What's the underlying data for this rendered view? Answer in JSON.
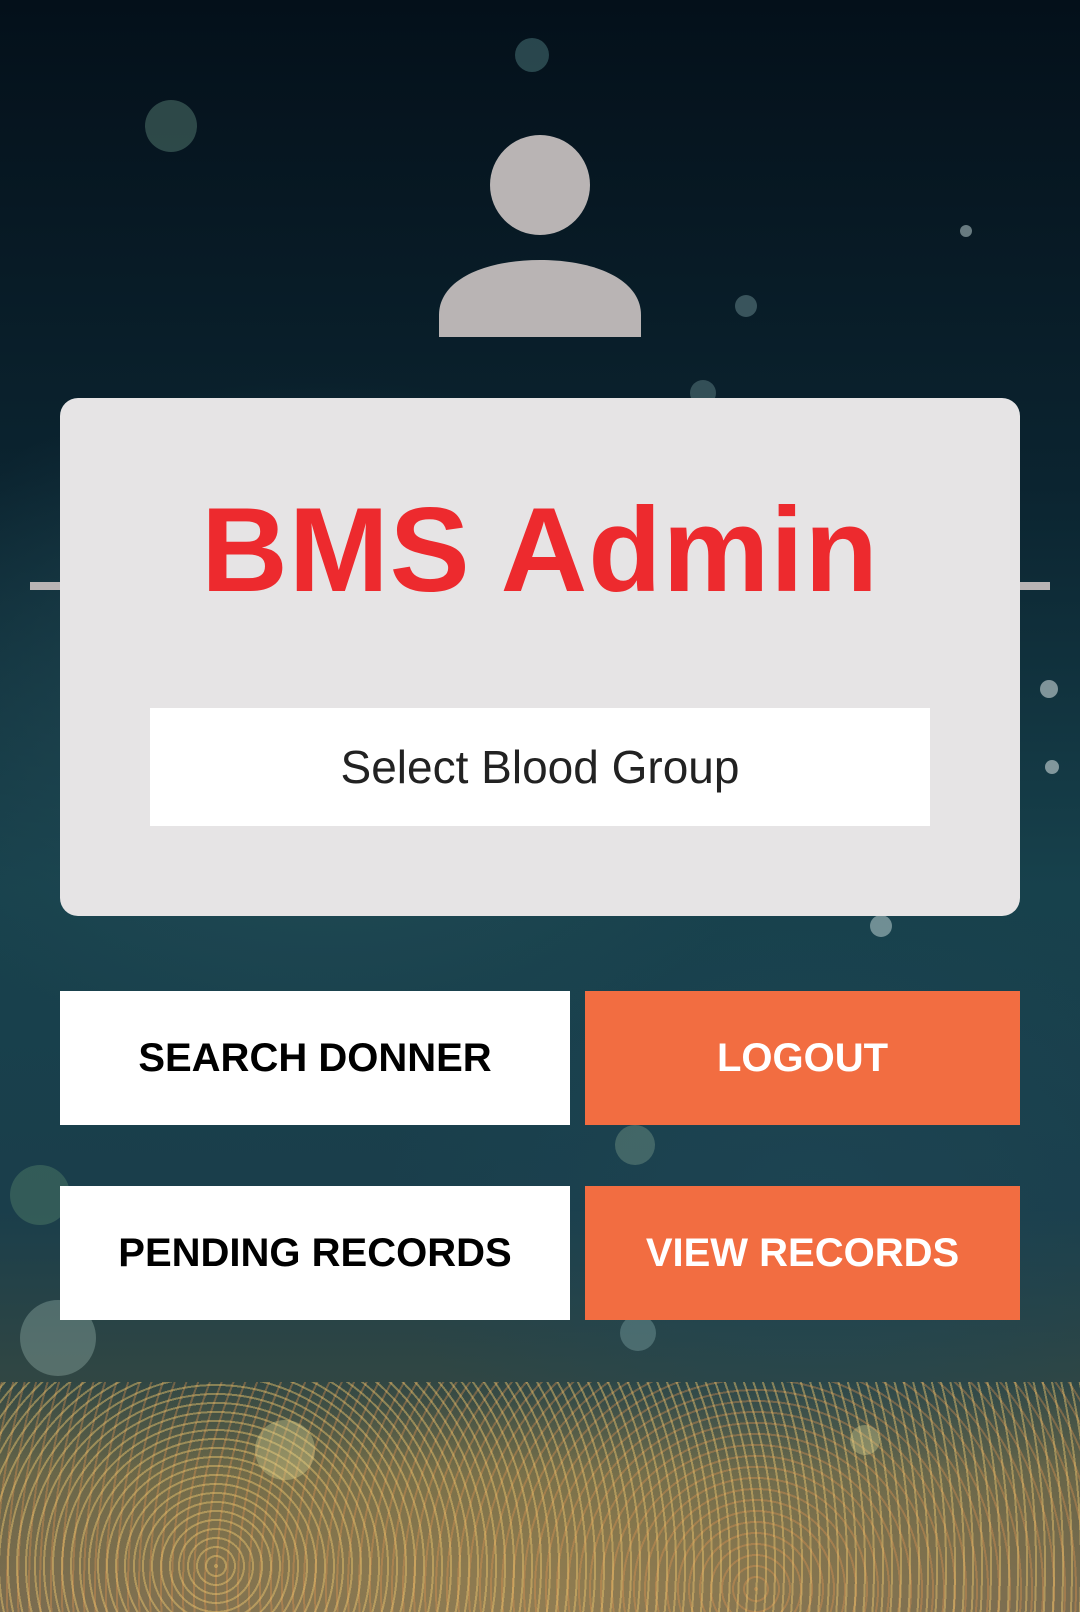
{
  "app": {
    "title": "BMS Admin"
  },
  "avatar": {
    "icon": "user-icon",
    "color": "#b9b4b4"
  },
  "form": {
    "blood_group_select": {
      "value": "Select Blood Group"
    }
  },
  "buttons": {
    "search_donner": "SEARCH DONNER",
    "logout": "LOGOUT",
    "pending_records": "PENDING RECORDS",
    "view_records": "VIEW RECORDS"
  },
  "colors": {
    "title": "#ed2a2e",
    "accent_button": "#f26d41",
    "card": "#e6e4e5"
  }
}
